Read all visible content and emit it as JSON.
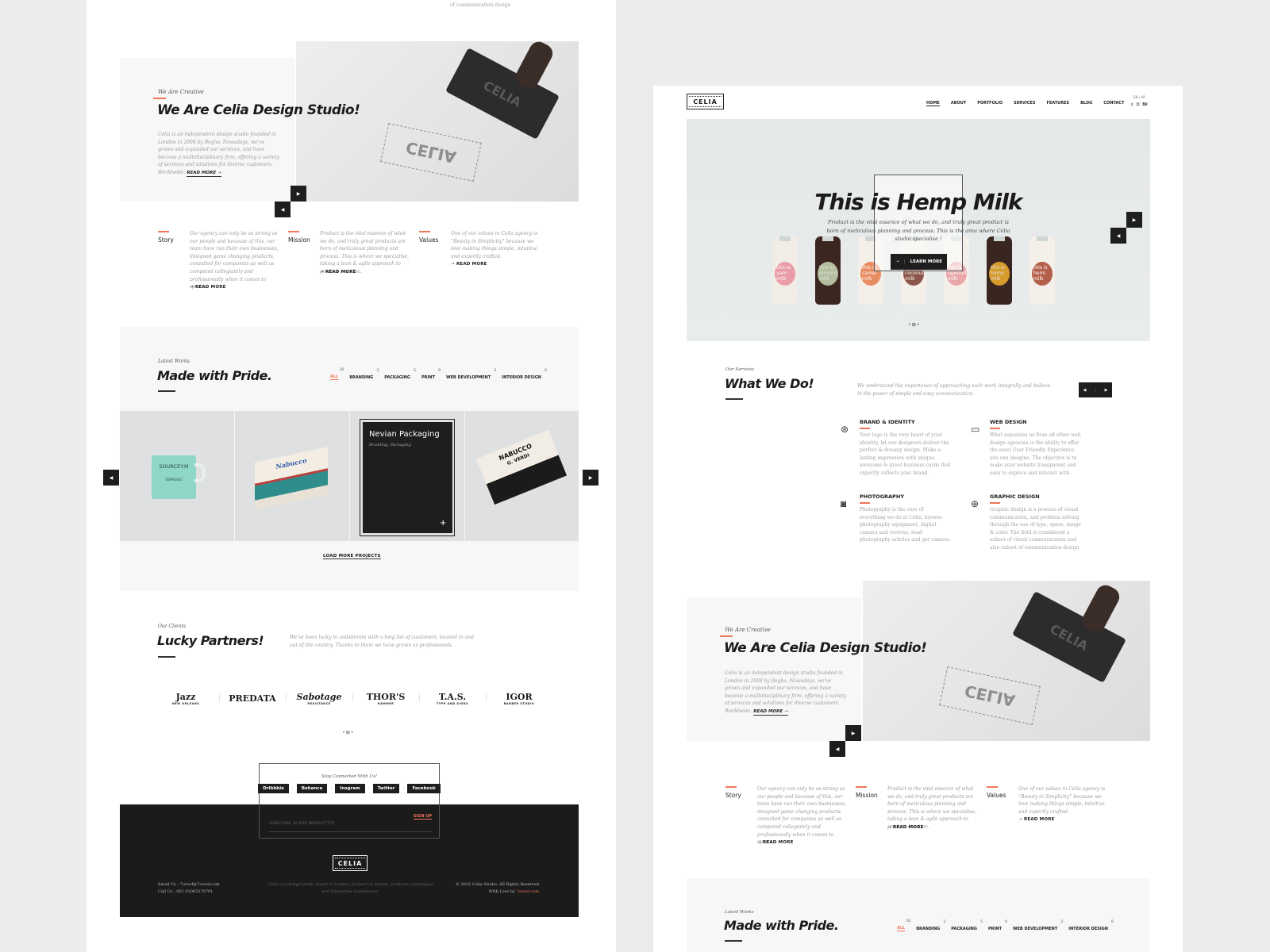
{
  "left_page": {
    "top_fragment": "of communication design",
    "about": {
      "eyebrow": "We Are Creative",
      "title": "We Are Celia Design Studio!",
      "body": "Celia is an independent design studio founded in London in 2008 by Begha. Nowadays, we've grown and expanded our services, and have become a multidisciplinary firm, offering a variety of services and solutions for diverse customers Worldwide.",
      "read_more": "READ MORE",
      "stamp_text": "CELIA",
      "prev_icon": "triangle-left-icon",
      "next_icon": "triangle-right-icon"
    },
    "trio": [
      {
        "title": "Story",
        "body": "Our agency can only be as strong as our people and because of this, our team have run their own businesses, designed game changing products, consulted for companies as well as competed collegiately and professionally when it comes to sports.",
        "link": "READ MORE"
      },
      {
        "title": "Mission",
        "body": "Product is the vital essence of what we do, and truly great products are born of meticulous planning and process. This is where we specialise, taking a lean & agile approach to product creation.",
        "link": "READ MORE"
      },
      {
        "title": "Values",
        "body": "One of our values in Celia agency is “Beauty in Simplicity” because we love making things simple, intuitive and expertly crafted.",
        "link": "READ MORE"
      }
    ],
    "works": {
      "eyebrow": "Latest Works",
      "title": "Made with Pride.",
      "filters": [
        {
          "label": "ALL",
          "count": "16",
          "active": true
        },
        {
          "label": "BRANDING",
          "count": "3"
        },
        {
          "label": "PACKAGING",
          "count": "5"
        },
        {
          "label": "PRINT",
          "count": "0"
        },
        {
          "label": "WEB DEVELOPMENT",
          "count": "2"
        },
        {
          "label": "INTERIOR DESIGN",
          "count": "6"
        }
      ],
      "tiles": [
        {
          "kind": "mug",
          "text": "SOURCEY.M",
          "sub": "ESPRESSO"
        },
        {
          "kind": "box",
          "text": "Nabucco"
        },
        {
          "kind": "overlay",
          "title": "Nevian Packaging",
          "tags": "Branding, Packaging",
          "plus": "+"
        },
        {
          "kind": "card",
          "text": "NABUCCO",
          "sub": "G. VERDI"
        }
      ],
      "load_more": "LOAD MORE PROJECTS"
    },
    "partners": {
      "eyebrow": "Our Clients",
      "title": "Lucky Partners!",
      "body": "We've been lucky to collaborate with a long list of customers, located in and out of the country. Thanks to them we have grown as professionals.",
      "logos": [
        {
          "name": "Jazz",
          "sub": "NEW ORLEANS"
        },
        {
          "name": "PREDATA",
          "sub": ""
        },
        {
          "name": "Sabotage",
          "sub": "RESISTANCE"
        },
        {
          "name": "THOR'S",
          "sub": "HAMMER"
        },
        {
          "name": "T.A.S.",
          "sub": "TYPE AND SIGNS"
        },
        {
          "name": "IGOR",
          "sub": "BARBER STUDIO"
        }
      ]
    },
    "footer": {
      "stay_connected": "Stay Connected With Us!",
      "socials": [
        "Dribbble",
        "Behance",
        "Insgram",
        "Twitter",
        "Facebook"
      ],
      "newsletter_placeholder": "SUBSCRIBE IN OUR NEWSLETTER",
      "sign_up": "SIGN UP",
      "logo": "CELIA",
      "email": "Email Us : 7oroof@7oroof.com",
      "phone": "Call Us : 002 01065370701",
      "about": "Celia is a design studio based in London, focused on brands, products, campaigns and interactive experiences.",
      "copyright": "© 2016 Celia Studio. All Rights Reserved",
      "credit_prefix": "With Love by ",
      "credit_link": "7oroof.com"
    }
  },
  "right_page": {
    "header": {
      "logo": "CELIA",
      "nav": [
        "HOME",
        "ABOUT",
        "PORTFOLIO",
        "SERVICES",
        "FEATURES",
        "BLOG",
        "CONTACT"
      ],
      "active_nav": "HOME",
      "lang": "EN | AR",
      "social_icons": [
        "twitter-icon",
        "instagram-icon",
        "behance-icon"
      ]
    },
    "hero": {
      "title": "This is Hemp Milk",
      "body": "Product is the vital essence of what we do, and truly great product is born of meticulous planning and process. This is the area where Celia studio specialise !",
      "cta": "LEARN MORE",
      "bottles": [
        {
          "label": "this is yam milk",
          "color": "#f1ece6",
          "blob": "#e88f9d"
        },
        {
          "label": "this is almond milk",
          "color": "#3b2620",
          "blob": "#c8d9b6"
        },
        {
          "label": "this is camel milk",
          "color": "#f4efe9",
          "blob": "#e77b4a"
        },
        {
          "label": "this is coconut milk",
          "color": "#f4efe9",
          "blob": "#7a3b2e"
        },
        {
          "label": "this is tigernut milk",
          "color": "#f4efe9",
          "blob": "#e99a9e"
        },
        {
          "label": "this is hemp milk",
          "color": "#3a2620",
          "blob": "#f2b02e"
        },
        {
          "label": "this is hemi milk",
          "color": "#f4efe9",
          "blob": "#a9462e"
        }
      ]
    },
    "services": {
      "eyebrow": "Our Services",
      "title": "What We Do!",
      "intro": "We understand the importance of approaching each work integrally and believe in the power of simple and easy communication.",
      "items": [
        {
          "icon": "brand-identity-icon",
          "title": "BRAND & IDENTITY",
          "body": "Your logo is the very heart of your identity, let our designers deliver the perfect & dreamy design. Make a lasting impression with unique, awesome & great business cards that expertly reflects your brand."
        },
        {
          "icon": "monitor-icon",
          "title": "WEB DESIGN",
          "body": "What separates us from all other web design agencies is the ability to offer the most User Friendly Experience you can imagine. The objective is to make your website transparent and easy to explore and interact with."
        },
        {
          "icon": "camera-icon",
          "title": "PHOTOGRAPHY",
          "body": "Photography is the core of everything we do at Celia, browse photography equipment, digital camera and reviews, read photography articles and get camera."
        },
        {
          "icon": "gamepad-icon",
          "title": "GRAPHIC DESIGN",
          "body": "Graphic design is a process of visual communication, and problem solving through the use of type, space, image & color. The field is considered a subset of visual communication and also subset of communication design"
        }
      ]
    },
    "about": {
      "eyebrow": "We Are Creative",
      "title": "We Are Celia Design Studio!",
      "body": "Celia is an independent design studio founded in London in 2008 by Begha. Nowadays, we've grown and expanded our services, and have become a multidisciplinary firm, offering a variety of services and solutions for diverse customers Worldwide.",
      "read_more": "READ MORE",
      "stamp_text": "CELIA"
    },
    "trio": [
      {
        "title": "Story",
        "body": "Our agency can only be as strong as our people and because of this, our team have run their own businesses, designed game changing products, consulted for companies as well as competed collegiately and professionally when it comes to sports.",
        "link": "READ MORE"
      },
      {
        "title": "Mission",
        "body": "Product is the vital essence of what we do, and truly great products are born of meticulous planning and process. This is where we specialise, taking a lean & agile approach to product creation.",
        "link": "READ MORE"
      },
      {
        "title": "Values",
        "body": "One of our values in Celia agency is “Beauty in Simplicity” because we love making things simple, intuitive and expertly crafted.",
        "link": "READ MORE"
      }
    ],
    "works": {
      "eyebrow": "Latest Works",
      "title": "Made with Pride.",
      "filters": [
        {
          "label": "ALL",
          "count": "16",
          "active": true
        },
        {
          "label": "BRANDING",
          "count": "3"
        },
        {
          "label": "PACKAGING",
          "count": "5"
        },
        {
          "label": "PRINT",
          "count": "0"
        },
        {
          "label": "WEB DEVELOPMENT",
          "count": "2"
        },
        {
          "label": "INTERIOR DESIGN",
          "count": "6"
        }
      ]
    }
  },
  "colors": {
    "accent": "#f0765a",
    "dark": "#1e1e1e",
    "canvas": "#ececec",
    "panel": "#f7f7f7"
  }
}
